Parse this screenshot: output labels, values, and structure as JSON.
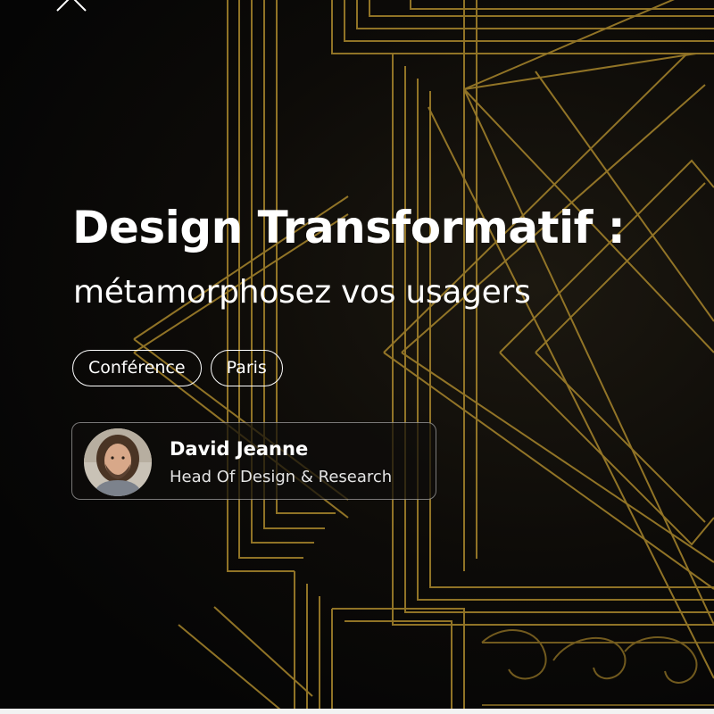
{
  "event": {
    "title": "Design Transformatif :",
    "subtitle": "métamorphosez vos usagers",
    "tags": [
      {
        "label": "Conférence"
      },
      {
        "label": "Paris"
      }
    ]
  },
  "speaker": {
    "name": "David Jeanne",
    "role": "Head Of Design & Research"
  },
  "colors": {
    "background": "#050505",
    "ornament_gold": "#b8922e",
    "text": "#ffffff"
  },
  "icons": {
    "corner": "chevron-up-icon",
    "background": "art-deco-ornament"
  }
}
